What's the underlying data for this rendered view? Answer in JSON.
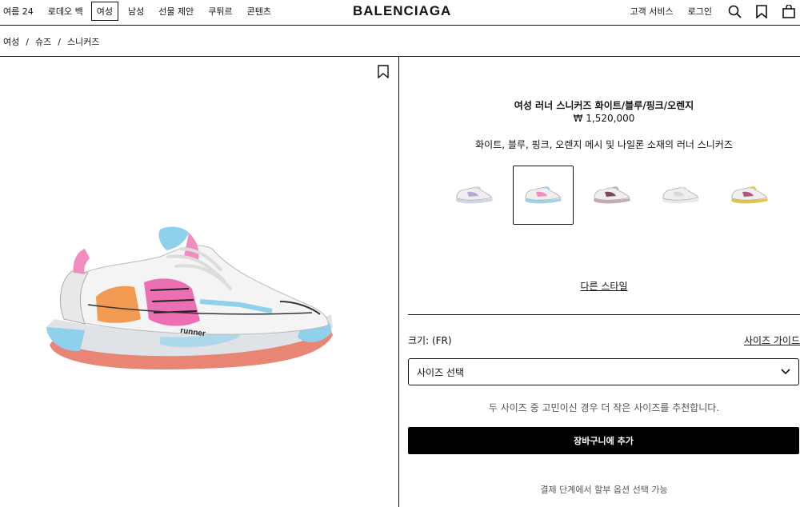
{
  "nav": {
    "left_items": [
      "여름 24",
      "로데오 백",
      "여성",
      "남성",
      "선물 제안",
      "쿠튀르",
      "콘텐츠"
    ],
    "active_index": 2,
    "logo": "BALENCIAGA",
    "right_items": [
      "고객 서비스",
      "로그인"
    ],
    "icons": [
      "search-icon",
      "bookmark-icon",
      "shopping-bag-icon"
    ]
  },
  "breadcrumb": [
    "여성",
    "슈즈",
    "스니커즈"
  ],
  "product": {
    "title": "여성 러너 스니커즈 화이트/블루/핑크/오렌지",
    "price": "₩ 1,520,000",
    "description": "화이트, 블루, 핑크, 오렌지 메시 및 나일론 소재의 러너 스니커즈",
    "variant_colors": [
      {
        "accent": "#b9a6d8",
        "sole": "#cfd6ea"
      },
      {
        "accent": "#f28bc0",
        "sole": "#9fd4e8"
      },
      {
        "accent": "#7a4a55",
        "sole": "#c9a9b1"
      },
      {
        "accent": "#d9d9d9",
        "sole": "#e9e9e9"
      },
      {
        "accent": "#b2567a",
        "sole": "#e5c44a"
      }
    ],
    "selected_variant": 1,
    "other_style_link": "다른 스타일"
  },
  "size": {
    "label": "크기: (FR)",
    "guide_link": "사이즈 가이드",
    "select_value": "사이즈 선택",
    "note": "두 사이즈 중 고민이신 경우 더 작은 사이즈를 추천합니다."
  },
  "cart": {
    "button": "장바구니에 추가",
    "payment_note": "결제 단계에서 할부 옵션 선택 가능"
  },
  "colors": {
    "accent_black": "#000000",
    "shoe_pink": "#ec6fb3",
    "shoe_blue": "#8fd0ea",
    "shoe_orange": "#f39a52",
    "shoe_sole_coral": "#e98575"
  }
}
